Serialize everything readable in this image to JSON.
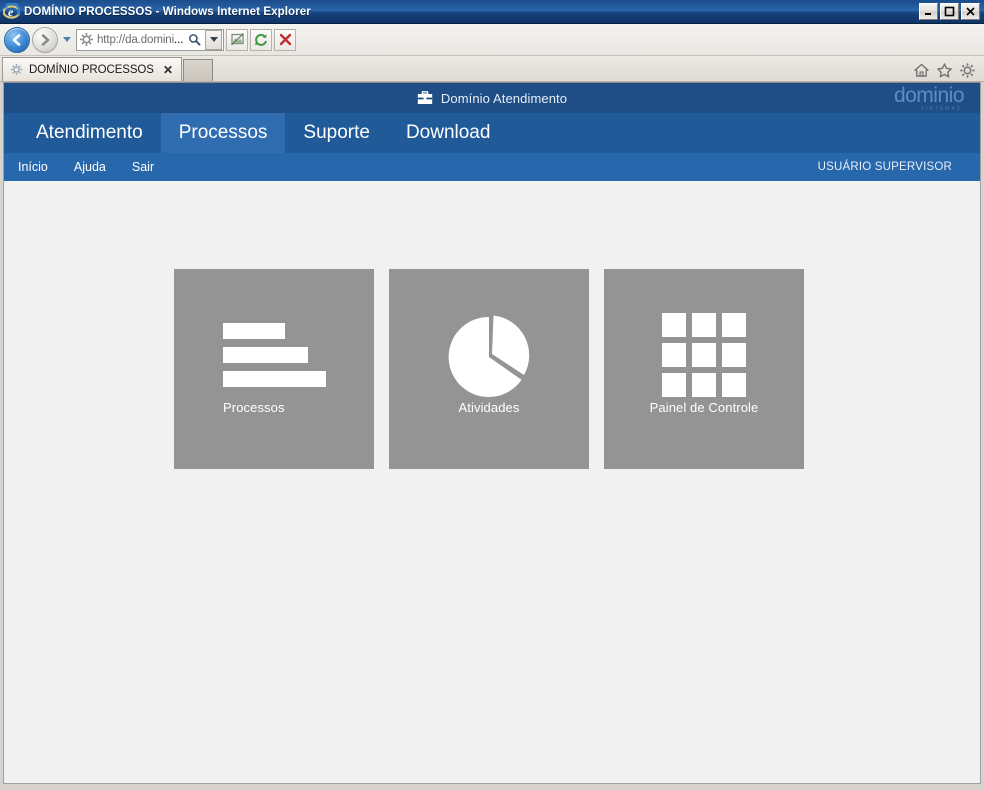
{
  "window": {
    "title": "DOMÍNIO PROCESSOS - Windows Internet Explorer",
    "app_icon": "internet-explorer-icon",
    "minimize_label": "Minimizar",
    "maximize_label": "Maximizar",
    "close_label": "Fechar"
  },
  "browser": {
    "back_label": "Voltar",
    "forward_label": "Avançar",
    "recent_pages_label": "Páginas recentes",
    "address": {
      "value": "http://da.domini",
      "ellipsis": "...",
      "placeholder": "http://",
      "site_icon": "gear-icon",
      "search_icon": "search-icon",
      "dropdown_icon": "chevron-down-icon"
    },
    "compat_view_label": "Modo de Exibição de Compatibilidade",
    "refresh_label": "Atualizar",
    "stop_label": "Parar",
    "tabs": [
      {
        "title": "DOMÍNIO PROCESSOS",
        "icon": "gear-icon",
        "close": "✕",
        "active": true
      }
    ],
    "new_tab_label": "Nova Guia",
    "right_icons": [
      {
        "name": "home-icon",
        "label": "Página Inicial"
      },
      {
        "name": "favorites-star-icon",
        "label": "Favoritos"
      },
      {
        "name": "tools-gear-icon",
        "label": "Ferramentas"
      }
    ]
  },
  "app": {
    "topbar": {
      "icon": "briefcase-icon",
      "title": "Domínio Atendimento",
      "brand_name": "dominio",
      "brand_sub": "SISTEMAS"
    },
    "nav": [
      {
        "label": "Atendimento",
        "active": false
      },
      {
        "label": "Processos",
        "active": true
      },
      {
        "label": "Suporte",
        "active": false
      },
      {
        "label": "Download",
        "active": false
      }
    ],
    "subnav": [
      {
        "label": "Início"
      },
      {
        "label": "Ajuda"
      },
      {
        "label": "Sair"
      }
    ],
    "user": "USUÁRIO SUPERVISOR",
    "tiles": [
      {
        "label": "Processos",
        "icon": "bar-chart-icon"
      },
      {
        "label": "Atividades",
        "icon": "pie-chart-icon"
      },
      {
        "label": "Painel de Controle",
        "icon": "grid-icon"
      }
    ]
  },
  "colors": {
    "titlebar_blue": "#1b4c8c",
    "app_topbar": "#1f4e87",
    "app_nav": "#215a99",
    "app_nav_active": "#2f6cb0",
    "app_subnav": "#2767ab",
    "tile_gray": "#949494",
    "page_bg": "#f1f1f1",
    "brand_blue": "#5f8bc2"
  }
}
